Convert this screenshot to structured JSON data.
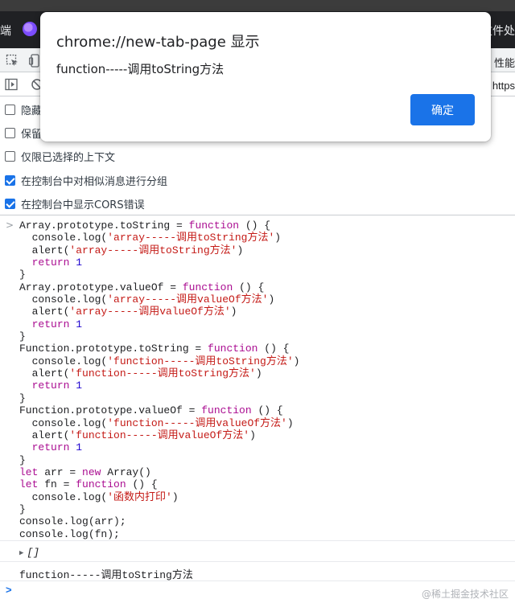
{
  "browser": {
    "tab_fragment_left": "端",
    "tab_fragment_right": "文件处"
  },
  "devtools": {
    "toolbar_right_label": "性能",
    "url_fragment": "https"
  },
  "settings": [
    {
      "label": "隐藏",
      "checked": false
    },
    {
      "label": "保留",
      "checked": false
    },
    {
      "label": "仅限已选择的上下文",
      "checked": false
    },
    {
      "label": "在控制台中对相似消息进行分组",
      "checked": true
    },
    {
      "label": "在控制台中显示CORS错误",
      "checked": true
    }
  ],
  "dialog": {
    "title": "chrome://new-tab-page 显示",
    "message": "function-----调用toString方法",
    "ok_label": "确定"
  },
  "console": {
    "code_lines": [
      [
        [
          "p",
          "Array.prototype.toString = "
        ],
        [
          "k",
          "function"
        ],
        [
          "p",
          " () {"
        ]
      ],
      [
        [
          "p",
          "  console.log("
        ],
        [
          "s",
          "'array-----调用toString方法'"
        ],
        [
          "p",
          ")"
        ]
      ],
      [
        [
          "p",
          "  alert("
        ],
        [
          "s",
          "'array-----调用toString方法'"
        ],
        [
          "p",
          ")"
        ]
      ],
      [
        [
          "p",
          "  "
        ],
        [
          "k",
          "return"
        ],
        [
          "p",
          " "
        ],
        [
          "n",
          "1"
        ]
      ],
      [
        [
          "p",
          "}"
        ]
      ],
      [
        [
          "p",
          "Array.prototype.valueOf = "
        ],
        [
          "k",
          "function"
        ],
        [
          "p",
          " () {"
        ]
      ],
      [
        [
          "p",
          "  console.log("
        ],
        [
          "s",
          "'array-----调用valueOf方法'"
        ],
        [
          "p",
          ")"
        ]
      ],
      [
        [
          "p",
          "  alert("
        ],
        [
          "s",
          "'array-----调用valueOf方法'"
        ],
        [
          "p",
          ")"
        ]
      ],
      [
        [
          "p",
          "  "
        ],
        [
          "k",
          "return"
        ],
        [
          "p",
          " "
        ],
        [
          "n",
          "1"
        ]
      ],
      [
        [
          "p",
          "}"
        ]
      ],
      [
        [
          "p",
          "Function.prototype.toString = "
        ],
        [
          "k",
          "function"
        ],
        [
          "p",
          " () {"
        ]
      ],
      [
        [
          "p",
          "  console.log("
        ],
        [
          "s",
          "'function-----调用toString方法'"
        ],
        [
          "p",
          ")"
        ]
      ],
      [
        [
          "p",
          "  alert("
        ],
        [
          "s",
          "'function-----调用toString方法'"
        ],
        [
          "p",
          ")"
        ]
      ],
      [
        [
          "p",
          "  "
        ],
        [
          "k",
          "return"
        ],
        [
          "p",
          " "
        ],
        [
          "n",
          "1"
        ]
      ],
      [
        [
          "p",
          "}"
        ]
      ],
      [
        [
          "p",
          "Function.prototype.valueOf = "
        ],
        [
          "k",
          "function"
        ],
        [
          "p",
          " () {"
        ]
      ],
      [
        [
          "p",
          "  console.log("
        ],
        [
          "s",
          "'function-----调用valueOf方法'"
        ],
        [
          "p",
          ")"
        ]
      ],
      [
        [
          "p",
          "  alert("
        ],
        [
          "s",
          "'function-----调用valueOf方法'"
        ],
        [
          "p",
          ")"
        ]
      ],
      [
        [
          "p",
          "  "
        ],
        [
          "k",
          "return"
        ],
        [
          "p",
          " "
        ],
        [
          "n",
          "1"
        ]
      ],
      [
        [
          "p",
          "}"
        ]
      ],
      [
        [
          "k",
          "let"
        ],
        [
          "p",
          " arr = "
        ],
        [
          "k",
          "new"
        ],
        [
          "p",
          " Array()"
        ]
      ],
      [
        [
          "k",
          "let"
        ],
        [
          "p",
          " fn = "
        ],
        [
          "k",
          "function"
        ],
        [
          "p",
          " () {"
        ]
      ],
      [
        [
          "p",
          "  console.log("
        ],
        [
          "s",
          "'函数内打印'"
        ],
        [
          "p",
          ")"
        ]
      ],
      [
        [
          "p",
          "}"
        ]
      ],
      [
        [
          "p",
          "console.log(arr);"
        ]
      ],
      [
        [
          "p",
          "console.log(fn);"
        ]
      ]
    ],
    "output_array": "[]",
    "output_log": "function-----调用toString方法"
  },
  "watermark": "@稀土掘金技术社区",
  "icons": {
    "inspect": "inspect-element-icon",
    "device": "device-toolbar-icon",
    "sidebar": "console-sidebar-icon",
    "clear": "clear-console-icon",
    "logo": "browser-app-logo-icon"
  },
  "colors": {
    "accent": "#1a73e8",
    "keyword": "#aa0d91",
    "string": "#c41a16",
    "number": "#1c00cf"
  }
}
